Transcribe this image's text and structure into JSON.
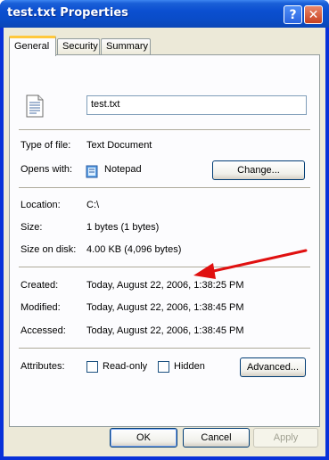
{
  "window": {
    "title": "test.txt Properties",
    "help_glyph": "?",
    "close_glyph": "✕"
  },
  "tabs": [
    {
      "label": "General",
      "active": true
    },
    {
      "label": "Security",
      "active": false
    },
    {
      "label": "Summary",
      "active": false
    }
  ],
  "general": {
    "file_name": "test.txt",
    "type_label": "Type of file:",
    "type_value": "Text Document",
    "opens_label": "Opens with:",
    "opens_value": "Notepad",
    "change_button": "Change...",
    "location_label": "Location:",
    "location_value": "C:\\",
    "size_label": "Size:",
    "size_value": "1 bytes (1 bytes)",
    "size_on_disk_label": "Size on disk:",
    "size_on_disk_value": "4.00 KB (4,096 bytes)",
    "created_label": "Created:",
    "created_value": "Today, August 22, 2006, 1:38:25 PM",
    "modified_label": "Modified:",
    "modified_value": "Today, August 22, 2006, 1:38:45 PM",
    "accessed_label": "Accessed:",
    "accessed_value": "Today, August 22, 2006, 1:38:45 PM",
    "attributes_label": "Attributes:",
    "readonly_label": "Read-only",
    "readonly_checked": false,
    "hidden_label": "Hidden",
    "hidden_checked": false,
    "advanced_button": "Advanced..."
  },
  "footer": {
    "ok": "OK",
    "cancel": "Cancel",
    "apply": "Apply"
  },
  "icons": [
    "text-file-icon",
    "notepad-icon",
    "help-icon",
    "close-icon",
    "annotation-arrow"
  ],
  "colors": {
    "titlebar": "#0b4fd0",
    "dialog_bg": "#ece9d8",
    "annotation_arrow": "#e01010"
  }
}
